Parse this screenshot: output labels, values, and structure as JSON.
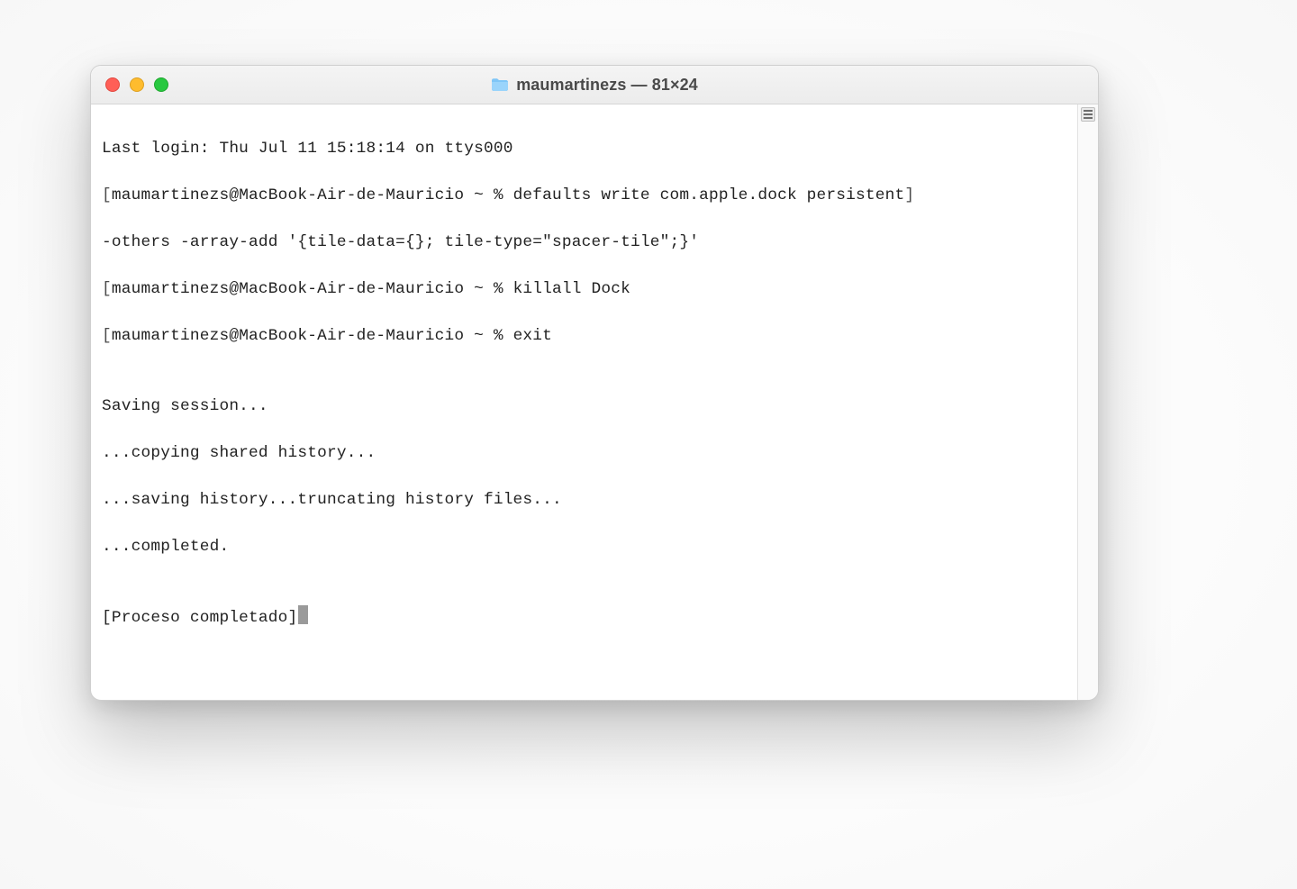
{
  "window": {
    "title": "maumartinezs — 81×24"
  },
  "terminal": {
    "lines": {
      "l0": "Last login: Thu Jul 11 15:18:14 on ttys000",
      "l1": "[",
      "l1b": "maumartinezs@MacBook-Air-de-Mauricio ~ % defaults write com.apple.dock persistent",
      "l1c": "]",
      "l2": "-others -array-add '{tile-data={}; tile-type=\"spacer-tile\";}'",
      "l3": "[",
      "l3b": "maumartinezs@MacBook-Air-de-Mauricio ~ % killall Dock",
      "l3c": "]",
      "l4": "[",
      "l4b": "maumartinezs@MacBook-Air-de-Mauricio ~ % exit",
      "l4c": "]",
      "blank1": "",
      "l5": "Saving session...",
      "l6": "...copying shared history...",
      "l7": "...saving history...truncating history files...",
      "l8": "...completed.",
      "blank2": "",
      "l9": "[Proceso completado]"
    }
  }
}
